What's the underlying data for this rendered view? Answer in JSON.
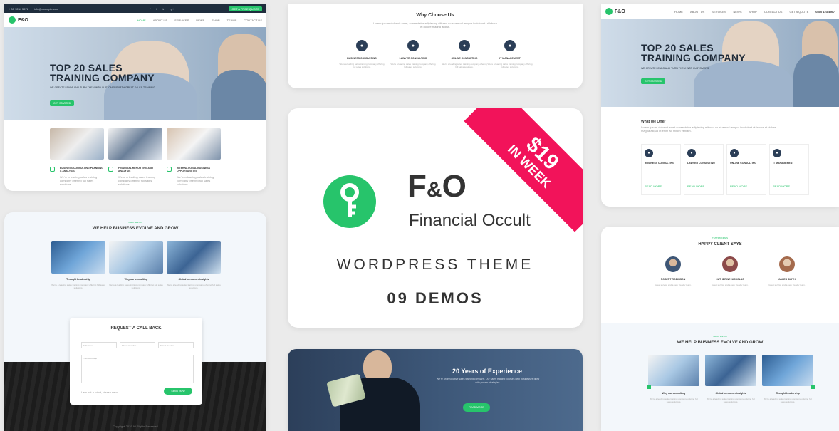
{
  "demo_left_top": {
    "topbar": [
      "+ 00 1234 5678",
      "info@example.com",
      "f",
      "t",
      "in",
      "g+"
    ],
    "topbar_cta": "GET A FREE QUOTE",
    "logo": "F&O",
    "nav": [
      "HOME",
      "ABOUT US",
      "SERVICES",
      "NEWS",
      "SHOP",
      "TEAMS",
      "CONTACT US"
    ],
    "hero_title": "TOP 20 SALES\nTRAINING COMPANY",
    "hero_sub": "WE CREATE LEADS AND TURN THEM INTO CUSTOMERS WITH GREAT SALES TRAINING",
    "hero_btn": "GET STARTED",
    "features": [
      {
        "title": "BUSINESS CONSULTING PLANNING & ANALYSIS",
        "text": "We're a leading sales training company offering full sales solutions."
      },
      {
        "title": "FINANCIAL REPORTING AND ANALYSIS",
        "text": "We're a leading sales training company offering full sales solutions."
      },
      {
        "title": "INTERNATIONAL BUSINESS OPPORTUNITIES",
        "text": "We're a leading sales training company offering full sales solutions."
      }
    ]
  },
  "demo_left_bottom": {
    "kicker": "WHAT WE DO",
    "heading": "WE HELP BUSINESS EVOLVE AND GROW",
    "items": [
      {
        "title": "Thought Leadership",
        "text": "We're a leading sales training company offering full sales solutions."
      },
      {
        "title": "Why our consulting",
        "text": "We're a leading sales training company offering full sales solutions."
      },
      {
        "title": "Global consumer insights",
        "text": "We're a leading sales training company offering full sales solutions."
      }
    ],
    "form_title": "REQUEST A CALL BACK",
    "field_name": "Full Name",
    "field_phone": "Phone Number",
    "field_select": "Select Service",
    "field_message": "Your Message",
    "form_checkbox": "I am not a robot, please send",
    "form_btn": "SEND NOW",
    "footer_text": "Copyright 2019 All Rights Reserved"
  },
  "center_top": {
    "heading": "Why Choose Us",
    "sub": "Lorem ipsum dolor sit amet, consectetur adipiscing elit sed do eiusmod tempor incididunt ut labore et dolore magna aliqua.",
    "services": [
      {
        "title": "BUSINESS CONSULTING",
        "text": "We're a leading sales training company offering full sales solutions."
      },
      {
        "title": "LAWYER CONSULTING",
        "text": "We're a leading sales training company offering full sales solutions."
      },
      {
        "title": "ONLINE CONSULTING",
        "text": "We're a leading sales training company offering full sales solutions."
      },
      {
        "title": "IT MANAGEMENT",
        "text": "We're a leading sales training company offering full sales solutions."
      }
    ]
  },
  "center_main": {
    "ribbon_price": "$19",
    "ribbon_text": "IN WEEK",
    "brand_left": "F",
    "brand_amp": "&",
    "brand_right": "O",
    "brand_tagline": "Financial Occult",
    "theme_label": "WORDPRESS THEME",
    "demos_label": "09 DEMOS"
  },
  "center_bottom": {
    "heading": "20 Years of Experience",
    "text": "We're an innovative sales training company. Our sales training courses help businesses grow with proven strategies.",
    "btn": "READ MORE"
  },
  "demo_right_top": {
    "logo": "F&O",
    "nav": [
      "HOME",
      "ABOUT US",
      "SERVICES",
      "NEWS",
      "SHOP",
      "CONTACT US",
      "GET A QUOTE"
    ],
    "phone": "0800 123 4567",
    "hero_title": "TOP 20 SALES\nTRAINING COMPANY",
    "hero_sub": "WE CREATE LEADS AND TURN THEM INTO CUSTOMERS",
    "hero_btn": "GET STARTED",
    "offer_heading": "What We Offer",
    "offer_text": "Lorem ipsum dolor sit amet consectetur adipiscing elit sed do eiusmod tempor incididunt ut labore et dolore magna aliqua ut enim ad minim veniam.",
    "services": [
      {
        "title": "BUSINESS CONSULTING",
        "more": "READ MORE"
      },
      {
        "title": "LAWYER CONSULTING",
        "more": "READ MORE"
      },
      {
        "title": "ONLINE CONSULTING",
        "more": "READ MORE"
      },
      {
        "title": "IT MANAGEMENT",
        "more": "READ MORE"
      }
    ]
  },
  "demo_right_bottom": {
    "kicker": "TESTIMONIALS",
    "heading": "HAPPY CLIENT SAYS",
    "clients": [
      {
        "name": "ROBERT ROBINSON",
        "text": "Great service and a very friendly team."
      },
      {
        "name": "KATHERINE NICHOLAS",
        "text": "Great service and a very friendly team."
      },
      {
        "name": "JAMES SMITH",
        "text": "Great service and a very friendly team."
      }
    ],
    "kicker2": "WHAT WE DO",
    "heading2": "WE HELP BUSINESS EVOLVE AND GROW",
    "items": [
      {
        "title": "Why our consulting",
        "text": "We're a leading sales training company offering full sales solutions."
      },
      {
        "title": "Global consumer insights",
        "text": "We're a leading sales training company offering full sales solutions."
      },
      {
        "title": "Thought Leadership",
        "text": "We're a leading sales training company offering full sales solutions."
      }
    ]
  },
  "colors": {
    "accent_green": "#27c46b",
    "ribbon_pink": "#f2135a",
    "dark_navy": "#1f2d3d",
    "background": "#ebebeb"
  }
}
